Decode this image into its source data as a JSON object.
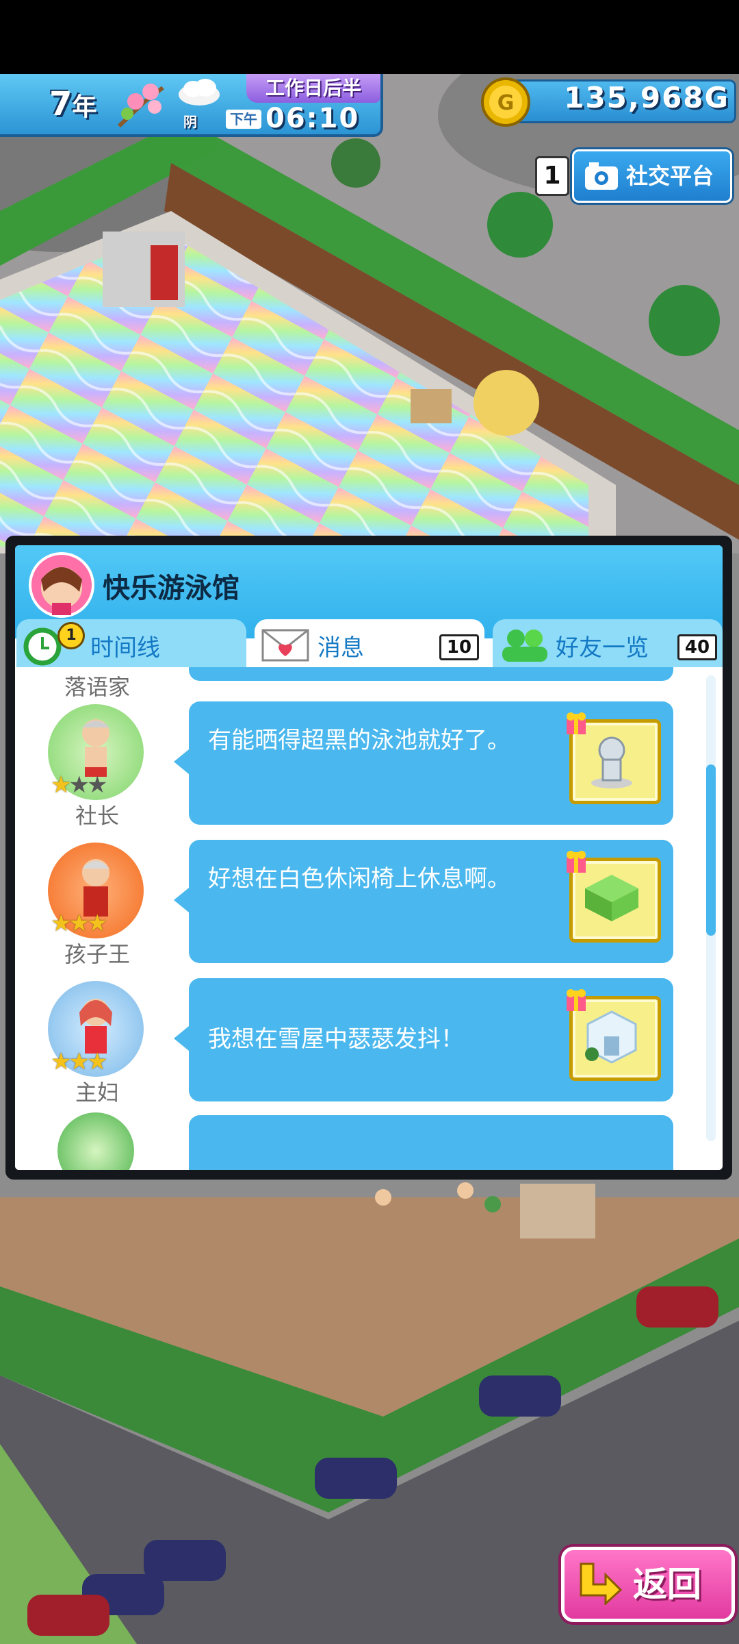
{
  "hud": {
    "year_number": "7",
    "year_unit": "年",
    "weather_label": "阴",
    "period_label": "工作日后半",
    "ampm_label": "下午",
    "time": "06:10",
    "money": "135,968",
    "money_unit": "G",
    "season_icon": "sakura-branch-icon",
    "weather_icon": "cloud-icon",
    "coin_icon": "gold-coin-icon"
  },
  "social": {
    "count": "1",
    "label": "社交平台",
    "icon": "camera-icon"
  },
  "panel": {
    "facility_name": "快乐游泳馆",
    "tabs": [
      {
        "label": "时间线",
        "badge": "1",
        "icon": "clock-icon"
      },
      {
        "label": "消息",
        "count": "10",
        "icon": "envelope-heart-icon"
      },
      {
        "label": "好友一览",
        "count": "40",
        "icon": "friends-icon"
      }
    ],
    "top_name": "落语家",
    "messages": [
      {
        "name": "社长",
        "stars": 1,
        "text": "有能晒得超黑的泳池就好了。",
        "gift_icon": "statue-gift-icon"
      },
      {
        "name": "孩子王",
        "stars": 3,
        "text": "好想在白色休闲椅上休息啊。",
        "gift_icon": "green-block-gift-icon"
      },
      {
        "name": "主妇",
        "stars": 3,
        "text": "我想在雪屋中瑟瑟发抖！",
        "gift_icon": "snow-house-gift-icon"
      }
    ]
  },
  "back_button": {
    "label": "返回",
    "icon": "return-arrow-icon"
  },
  "colors": {
    "panel_blue": "#4ab8ee",
    "header_blue": "#31b1ec",
    "back_pink": "#e23aa0",
    "star_gold": "#f3c21c"
  }
}
